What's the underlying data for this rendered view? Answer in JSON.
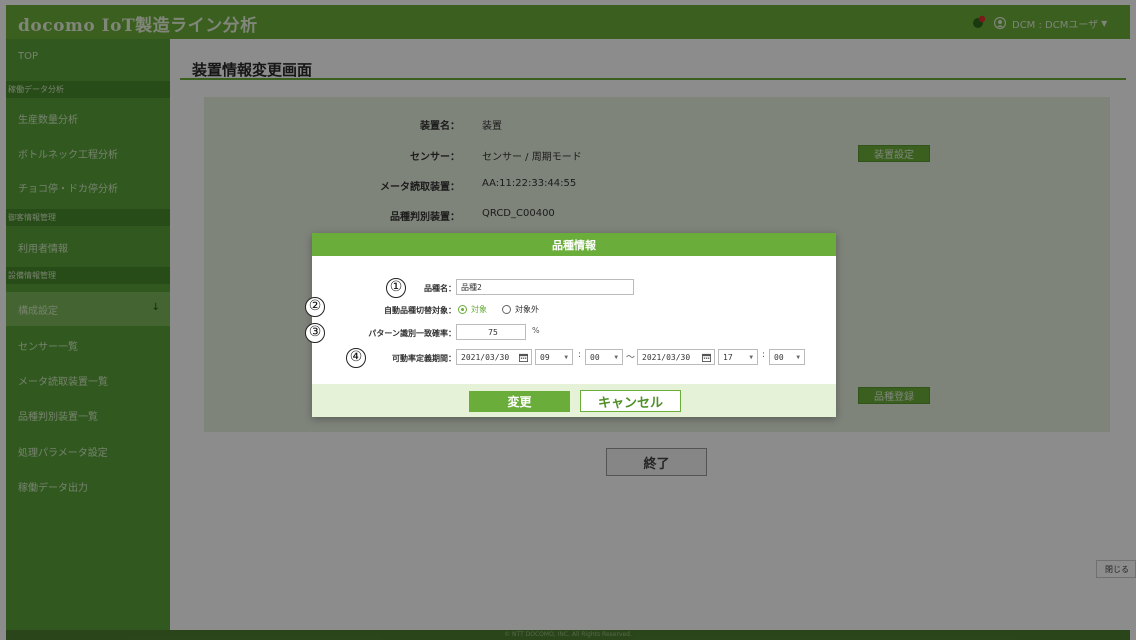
{
  "header": {
    "app_title": "docomo IoT製造ライン分析",
    "user_label": "DCM : DCMユーザ",
    "user_caret": "▼"
  },
  "sidebar": {
    "top": "TOP",
    "section_operation": "稼働データ分析",
    "item_production": "生産数量分析",
    "item_bottleneck": "ボトルネック工程分析",
    "item_stoppage": "チョコ停・ドカ停分析",
    "section_user": "御客情報管理",
    "item_user_info": "利用者情報",
    "section_equipment": "設備情報管理",
    "item_config": "構成設定",
    "item_config_arrow": "↓",
    "item_sensor_list": "センサー一覧",
    "item_meter_list": "メータ読取装置一覧",
    "item_product_list": "品種判別装置一覧",
    "item_params": "処理パラメータ設定",
    "item_export": "稼働データ出力"
  },
  "main": {
    "page_title": "装置情報変更画面",
    "device_name_label": "装置名：",
    "device_name_value": "装置",
    "sensor_label": "センサー：",
    "sensor_value": "センサー / 周期モード",
    "sensor_button": "装置設定",
    "meter_label": "メータ読取装置：",
    "meter_value": "AA:11:22:33:44:55",
    "product_device_label": "品種判別装置：",
    "product_device_value": "QRCD_C00400",
    "product_register_button": "品種登録",
    "end_button": "終了",
    "close_tab": "閉じる",
    "footer": "© NTT DOCOMO, INC. All Rights Reserved."
  },
  "modal": {
    "title": "品種情報",
    "num1": "①",
    "num2": "②",
    "num3": "③",
    "num4": "④",
    "product_name_label": "品種名：",
    "product_name_value": "品種2",
    "auto_switch_label": "自動品種切替対象：",
    "radio_target": "対象",
    "radio_non_target": "対象外",
    "pattern_label": "パターン識別一致確率：",
    "pattern_value": "75",
    "pattern_unit": "%",
    "period_label": "可動率定義期間：",
    "start_date": "2021/03/30",
    "start_hour": "09",
    "start_min": "00",
    "colon": ":",
    "tilde": "～",
    "end_date": "2021/03/30",
    "end_hour": "17",
    "end_min": "00",
    "change_button": "変更",
    "cancel_button": "キャンセル"
  },
  "colors": {
    "brand_green": "#6aad3a",
    "sidebar_green": "#5aa23a"
  }
}
